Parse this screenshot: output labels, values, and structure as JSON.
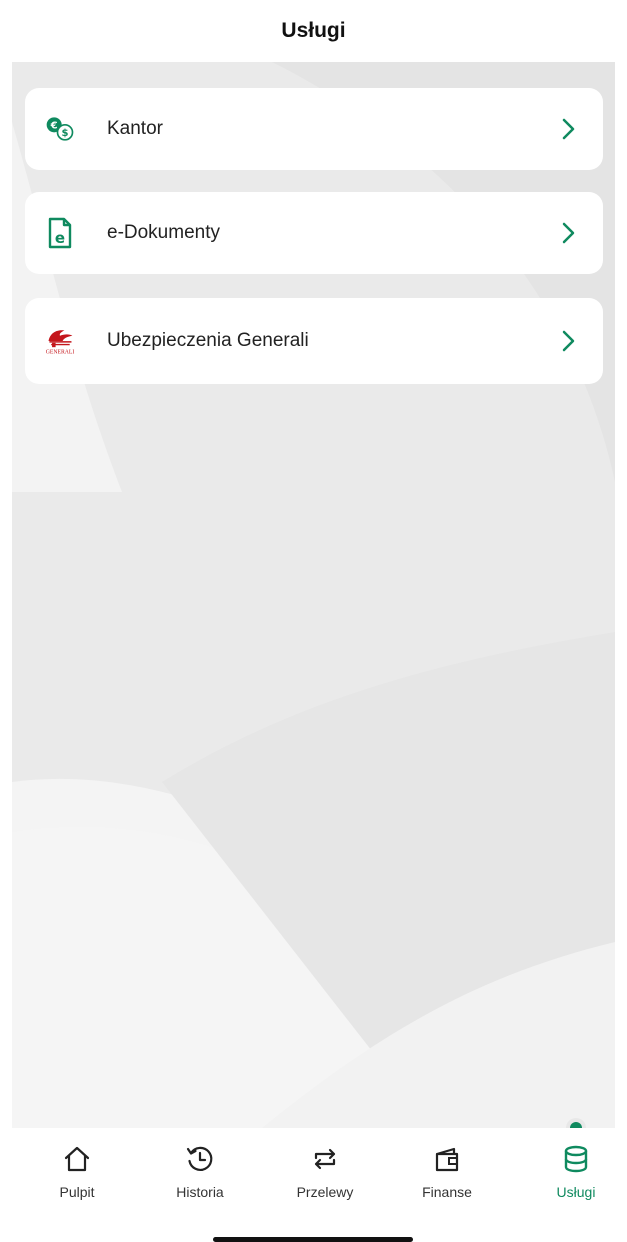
{
  "header": {
    "title": "Usługi"
  },
  "services": [
    {
      "label": "Kantor",
      "icon": "currency-exchange-icon"
    },
    {
      "label": "e-Dokumenty",
      "icon": "e-document-icon"
    },
    {
      "label": "Ubezpieczenia Generali",
      "icon": "generali-logo"
    }
  ],
  "generali_logo_text": "GENERALI",
  "tabs": [
    {
      "label": "Pulpit",
      "icon": "home-icon"
    },
    {
      "label": "Historia",
      "icon": "history-icon"
    },
    {
      "label": "Przelewy",
      "icon": "transfer-icon"
    },
    {
      "label": "Finanse",
      "icon": "wallet-icon"
    },
    {
      "label": "Usługi",
      "icon": "database-icon",
      "active": true
    }
  ],
  "colors": {
    "accent": "#0f8a5f",
    "generali_red": "#c4161c",
    "background": "#ececec"
  }
}
